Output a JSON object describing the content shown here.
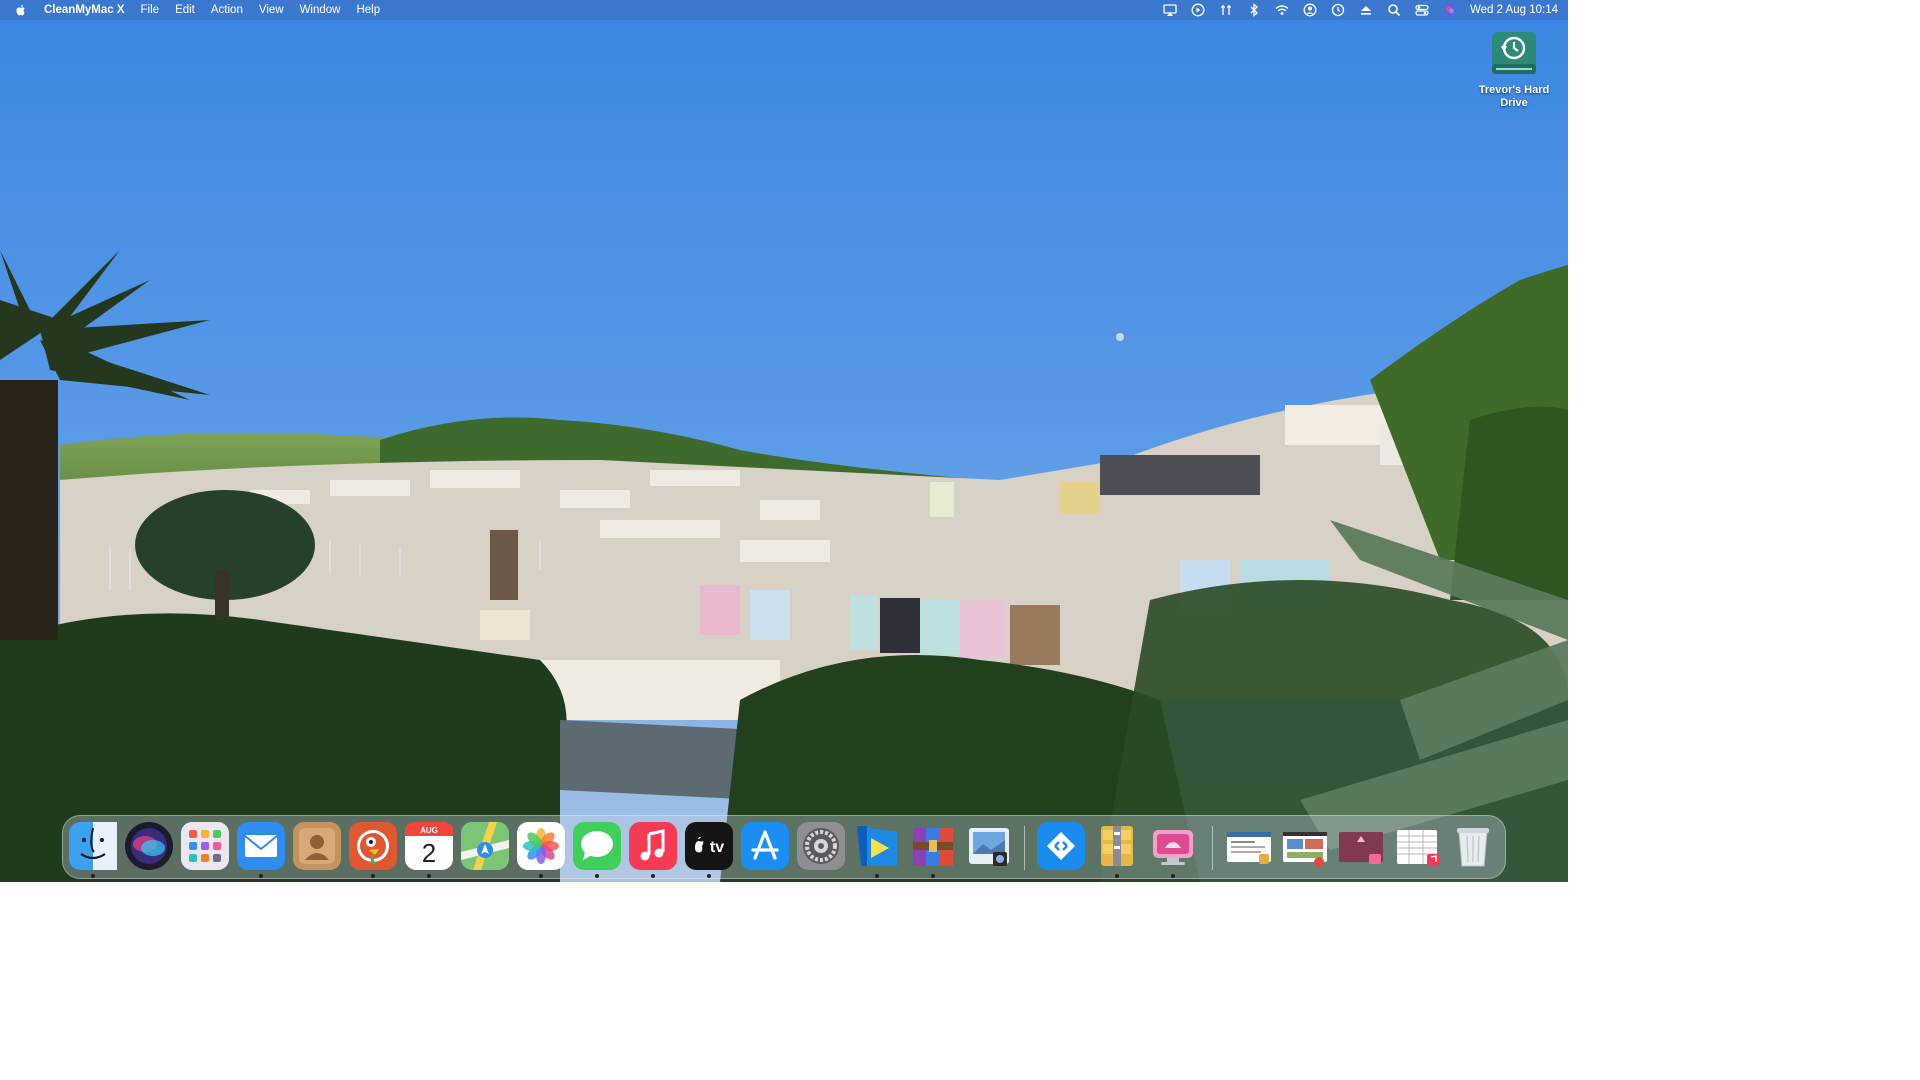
{
  "menubar": {
    "app_name": "CleanMyMac X",
    "menus": [
      "File",
      "Edit",
      "Action",
      "View",
      "Window",
      "Help"
    ],
    "status_icons": [
      "display-mirroring-icon",
      "play-circle-icon",
      "antenna-icon",
      "bluetooth-icon",
      "wifi-icon",
      "user-circle-icon",
      "time-machine-icon",
      "eject-icon",
      "search-icon",
      "control-center-icon",
      "siri-icon"
    ],
    "clock": "Wed 2 Aug  10:14"
  },
  "desktop": {
    "drive_label": "Trevor's Hard Drive"
  },
  "dock": {
    "apps": [
      "Finder",
      "Siri",
      "Launchpad",
      "Mail",
      "Contacts",
      "DuckDuckGo",
      "Calendar",
      "Maps",
      "Photos",
      "Messages",
      "Music",
      "TV",
      "App Store",
      "System Settings",
      "Infuse",
      "RAR Archiver",
      "Preview",
      "Remote Desktop",
      "Archive Utility",
      "CleanMyMac X",
      "Document 1",
      "Document 2",
      "Document 3",
      "Document 4",
      "Trash"
    ],
    "calendar_month": "AUG",
    "calendar_day": "2",
    "tv_label": "tv"
  }
}
